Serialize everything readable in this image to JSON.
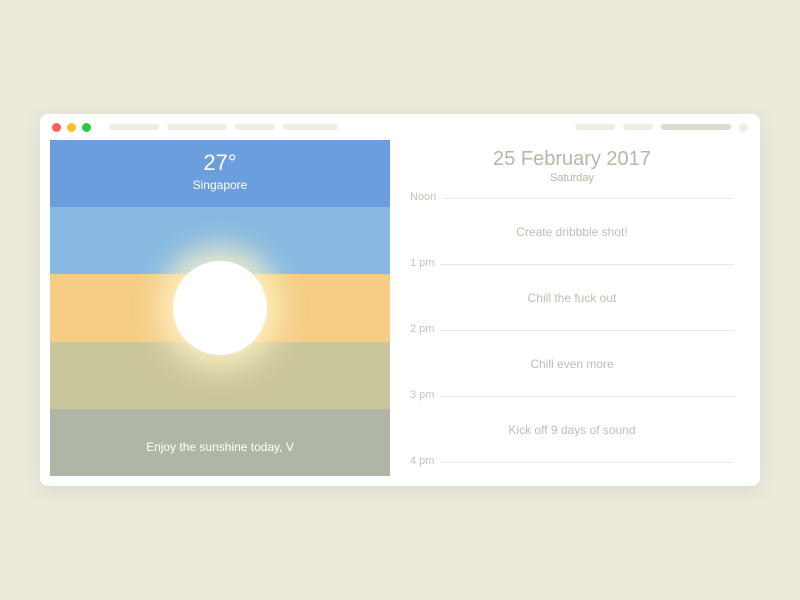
{
  "weather": {
    "temperature": "27°",
    "location": "Singapore",
    "message": "Enjoy the sunshine today, V"
  },
  "schedule": {
    "date": "25 February 2017",
    "day": "Saturday",
    "times": [
      "Noon",
      "1 pm",
      "2 pm",
      "3 pm",
      "4 pm"
    ],
    "events": [
      "Create dribbble shot!",
      "Chill the fuck out",
      "Chill even more",
      "Kick off 9 days of sound"
    ]
  },
  "colors": {
    "stripe1": "#6a9edc",
    "stripe2": "#87b9e2",
    "stripe3": "#f5cd87",
    "stripe4": "#cac69b",
    "stripe5": "#b0b6a5",
    "background": "#eceadb"
  }
}
